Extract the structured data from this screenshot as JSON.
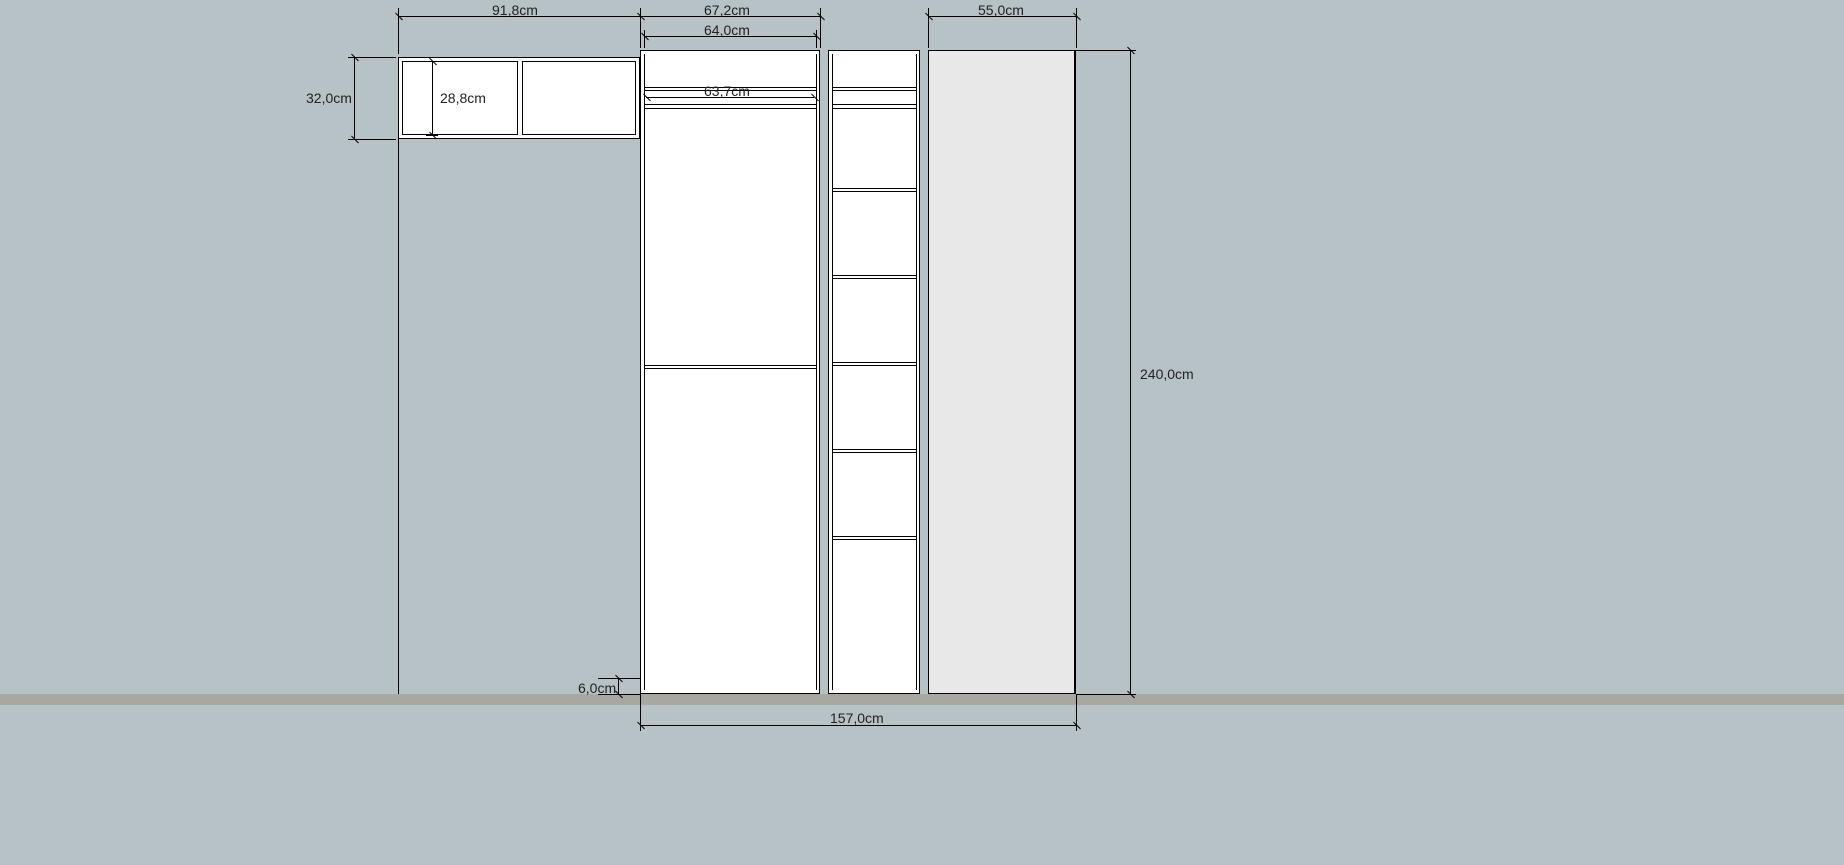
{
  "dimensions": {
    "top_918": "91,8cm",
    "top_672": "67,2cm",
    "top_640": "64,0cm",
    "top_550": "55,0cm",
    "inner_637": "63,7cm",
    "height_320": "32,0cm",
    "height_288": "28,8cm",
    "bottom_60": "6,0cm",
    "bottom_1570": "157,0cm",
    "height_2400": "240,0cm"
  }
}
